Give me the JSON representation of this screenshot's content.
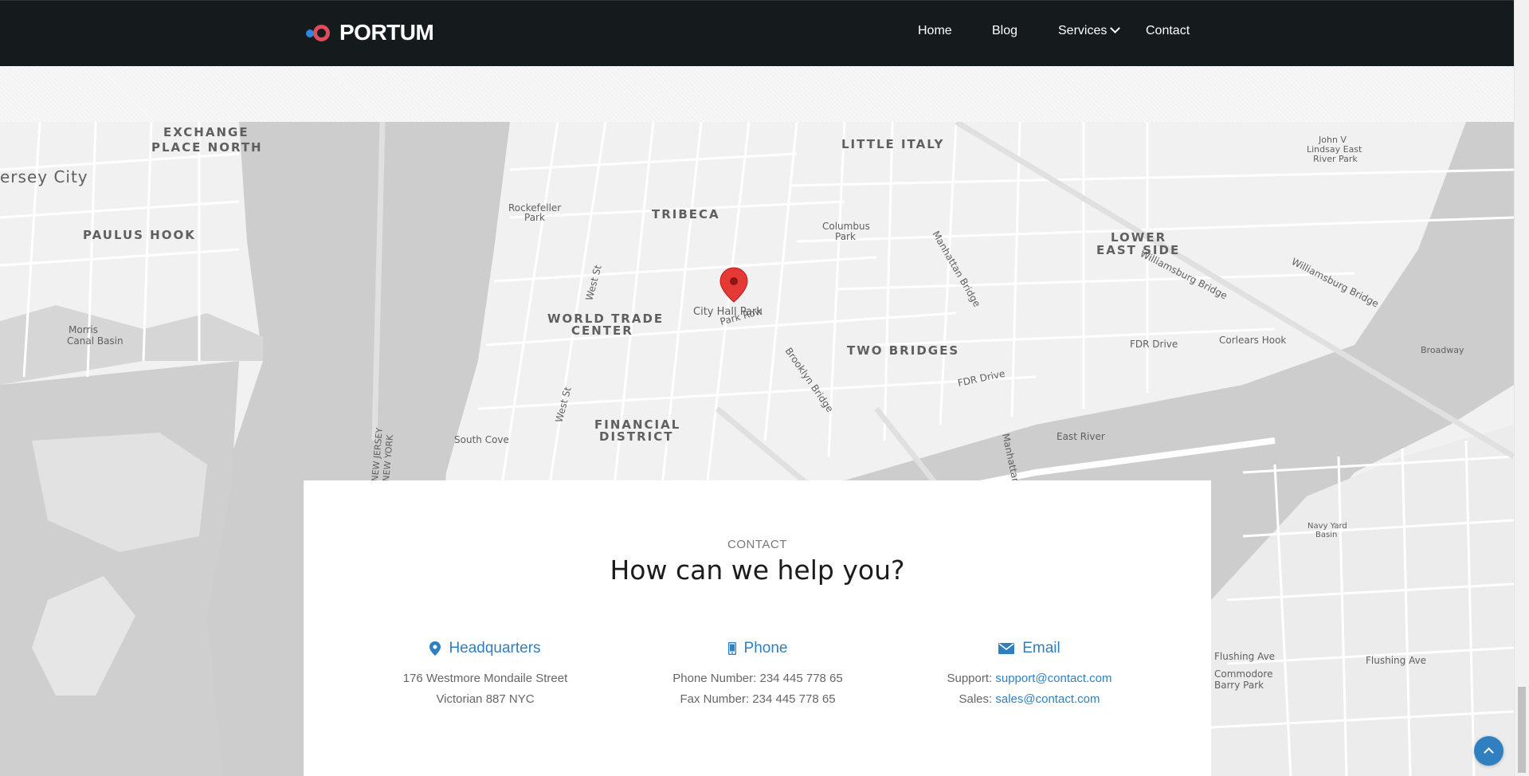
{
  "header": {
    "brand": "PORTUM",
    "nav": [
      {
        "label": "Home"
      },
      {
        "label": "Blog"
      },
      {
        "label": "Services"
      },
      {
        "label": "Contact"
      }
    ]
  },
  "map": {
    "pin_label": "City Hall Park",
    "labels": {
      "exchange_place": "EXCHANGE\nPLACE NORTH",
      "jersey_city": "ersey City",
      "paulus_hook": "PAULUS HOOK",
      "morris_canal": "Morris\nCanal Basin",
      "tribeca": "TRIBECA",
      "little_italy": "LITTLE ITALY",
      "lower_east_side": "LOWER\nEAST SIDE",
      "world_trade": "WORLD TRADE\nCENTER",
      "two_bridges": "TWO BRIDGES",
      "financial": "FINANCIAL\nDISTRICT",
      "corlears": "Corlears Hook",
      "south_cove": "South Cove",
      "east_river": "East River",
      "fdr_drive": "FDR Drive",
      "williamsburg": "Williamsburg Bridge",
      "columbus_park": "Columbus\nPark",
      "rockefeller_park": "Rockefeller\nPark",
      "flushing_ave": "Flushing Ave",
      "commodore": "Commodore\nBarry Park",
      "navy_yard": "Navy Yard\nBasin",
      "park_row": "Park Row",
      "brooklyn_bridge": "Brooklyn Bridge",
      "west_st": "West St",
      "manhattan_bridge": "Manhattan Bridge",
      "jersey_ny": "NEW JERSEY\nNEW YORK",
      "lindsay": "John V\nLindsay East\nRiver Park",
      "broadway": "Broadway"
    }
  },
  "contact": {
    "eyebrow": "CONTACT",
    "headline": "How can we help you?",
    "headquarters": {
      "title": "Headquarters",
      "line1": "176 Westmore Mondaile Street",
      "line2": "Victorian 887 NYC"
    },
    "phone": {
      "title": "Phone",
      "line1": "Phone Number: 234 445 778 65",
      "line2": "Fax Number: 234 445 778 65"
    },
    "email": {
      "title": "Email",
      "support_label": "Support:",
      "support_email": "support@contact.com",
      "sales_label": "Sales:",
      "sales_email": "sales@contact.com"
    }
  },
  "colors": {
    "header_bg": "#151a1d",
    "accent": "#2f7fc1",
    "pin": "#e53935"
  },
  "icons": {
    "headquarters": "map-pin-icon",
    "phone": "mobile-phone-icon",
    "email": "envelope-icon",
    "back_to_top": "chevron-up-icon"
  }
}
